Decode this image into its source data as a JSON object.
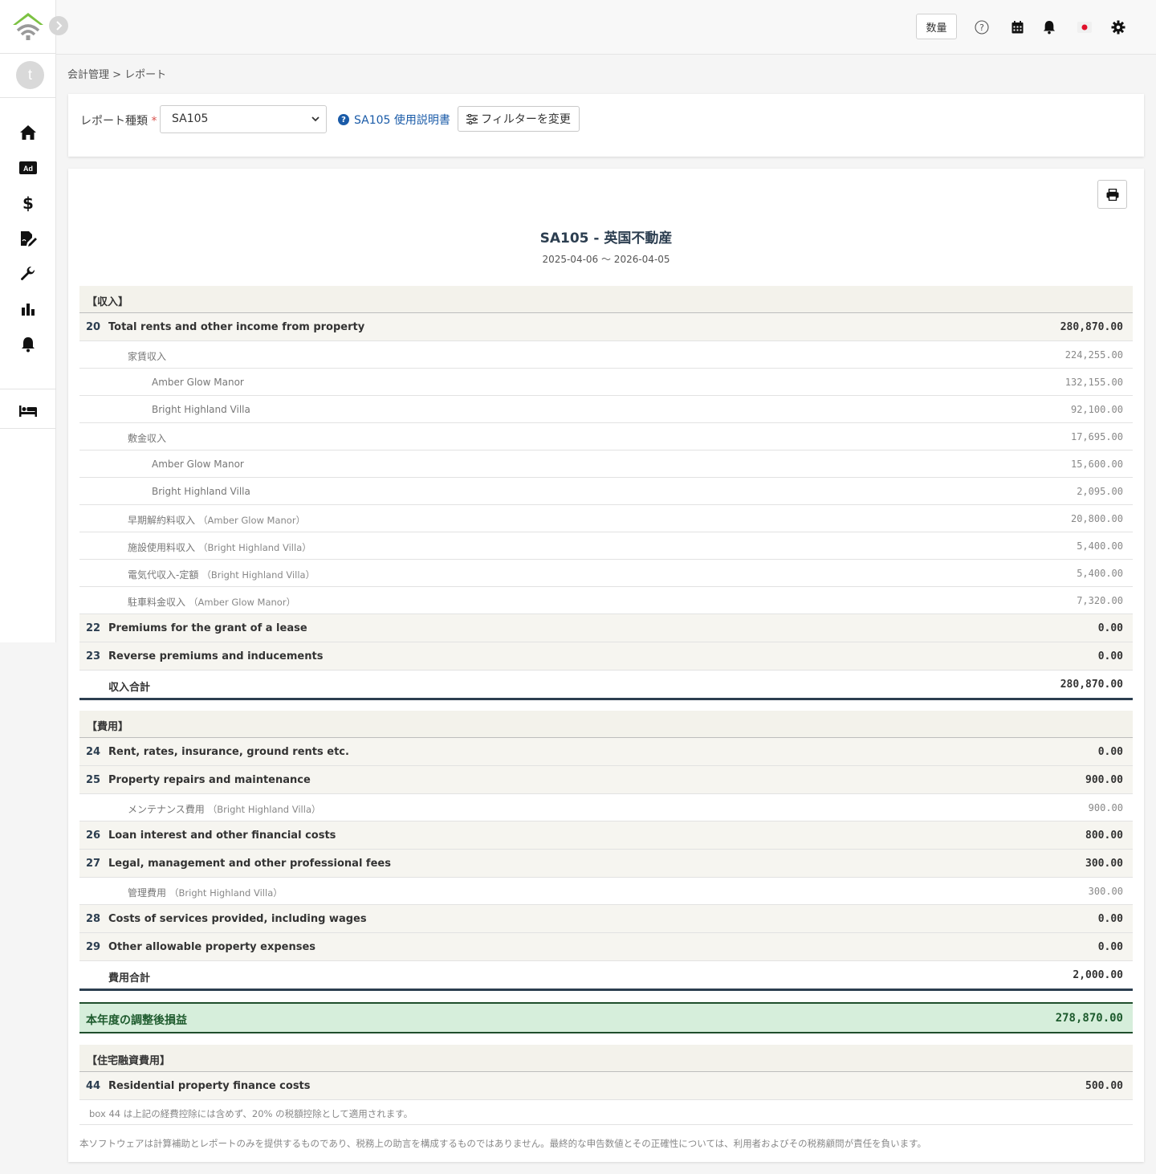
{
  "header": {
    "qty_label": "数量",
    "icons": [
      "help-icon",
      "calendar-icon",
      "bell-icon",
      "japan-flag-icon",
      "gear-icon"
    ]
  },
  "sidebar": {
    "avatar_initial": "t",
    "items": [
      "home-icon",
      "ad-icon",
      "dollar-icon",
      "document-edit-icon",
      "wrench-icon",
      "bar-chart-icon",
      "bell-icon",
      "bed-icon"
    ]
  },
  "breadcrumb": "会計管理 > レポート",
  "filter": {
    "label": "レポート種類",
    "required_mark": "*",
    "selected": "SA105",
    "help_link": "SA105 使用説明書",
    "filter_button": "フィルターを変更"
  },
  "report": {
    "title": "SA105 - 英国不動産",
    "period": "2025-04-06 〜 2026-04-05",
    "income_section": "【収入】",
    "expense_section": "【費用】",
    "finance_section": "【住宅融資費用】",
    "income_rows": [
      {
        "type": "box",
        "num": "20",
        "label": "Total rents and other income from property",
        "amount": "280,870.00"
      },
      {
        "type": "sub",
        "indent": 1,
        "label": "家賃収入",
        "paren": "",
        "amount": "224,255.00"
      },
      {
        "type": "sub",
        "indent": 2,
        "label": "Amber Glow Manor",
        "paren": "",
        "amount": "132,155.00"
      },
      {
        "type": "sub",
        "indent": 2,
        "label": "Bright Highland Villa",
        "paren": "",
        "amount": "92,100.00"
      },
      {
        "type": "sub",
        "indent": 1,
        "label": "敷金収入",
        "paren": "",
        "amount": "17,695.00"
      },
      {
        "type": "sub",
        "indent": 2,
        "label": "Amber Glow Manor",
        "paren": "",
        "amount": "15,600.00"
      },
      {
        "type": "sub",
        "indent": 2,
        "label": "Bright Highland Villa",
        "paren": "",
        "amount": "2,095.00"
      },
      {
        "type": "sub",
        "indent": 1,
        "label": "早期解約料収入",
        "paren": "（Amber Glow Manor）",
        "amount": "20,800.00"
      },
      {
        "type": "sub",
        "indent": 1,
        "label": "施設使用料収入",
        "paren": "（Bright Highland Villa）",
        "amount": "5,400.00"
      },
      {
        "type": "sub",
        "indent": 1,
        "label": "電気代収入-定額",
        "paren": "（Bright Highland Villa）",
        "amount": "5,400.00"
      },
      {
        "type": "sub",
        "indent": 1,
        "label": "駐車料金収入",
        "paren": "（Amber Glow Manor）",
        "amount": "7,320.00"
      },
      {
        "type": "box",
        "num": "22",
        "label": "Premiums for the grant of a lease",
        "amount": "0.00"
      },
      {
        "type": "box",
        "num": "23",
        "label": "Reverse premiums and inducements",
        "amount": "0.00"
      }
    ],
    "income_total": {
      "label": "収入合計",
      "amount": "280,870.00"
    },
    "expense_rows": [
      {
        "type": "box",
        "num": "24",
        "label": "Rent, rates, insurance, ground rents etc.",
        "amount": "0.00"
      },
      {
        "type": "box",
        "num": "25",
        "label": "Property repairs and maintenance",
        "amount": "900.00"
      },
      {
        "type": "sub",
        "indent": 1,
        "label": "メンテナンス費用",
        "paren": "（Bright Highland Villa）",
        "amount": "900.00"
      },
      {
        "type": "box",
        "num": "26",
        "label": "Loan interest and other financial costs",
        "amount": "800.00"
      },
      {
        "type": "box",
        "num": "27",
        "label": "Legal, management and other professional fees",
        "amount": "300.00"
      },
      {
        "type": "sub",
        "indent": 1,
        "label": "管理費用",
        "paren": "（Bright Highland Villa）",
        "amount": "300.00"
      },
      {
        "type": "box",
        "num": "28",
        "label": "Costs of services provided, including wages",
        "amount": "0.00"
      },
      {
        "type": "box",
        "num": "29",
        "label": "Other allowable property expenses",
        "amount": "0.00"
      }
    ],
    "expense_total": {
      "label": "費用合計",
      "amount": "2,000.00"
    },
    "profit": {
      "label": "本年度の調整後損益",
      "amount": "278,870.00"
    },
    "finance_rows": [
      {
        "type": "box",
        "num": "44",
        "label": "Residential property finance costs",
        "amount": "500.00"
      }
    ],
    "finance_note": "box 44 は上記の経費控除には含めず、20% の税額控除として適用されます。",
    "disclaimer": "本ソフトウェアは計算補助とレポートのみを提供するものであり、税務上の助言を構成するものではありません。最終的な申告数値とその正確性については、利用者およびその税務顧問が責任を負います。"
  },
  "colors": {
    "brand_green": "#7cc242",
    "link_blue": "#1a5ba8",
    "profit_bg": "#d6eedb",
    "profit_text": "#1e5b2e",
    "total_rule": "#2c3e50"
  }
}
